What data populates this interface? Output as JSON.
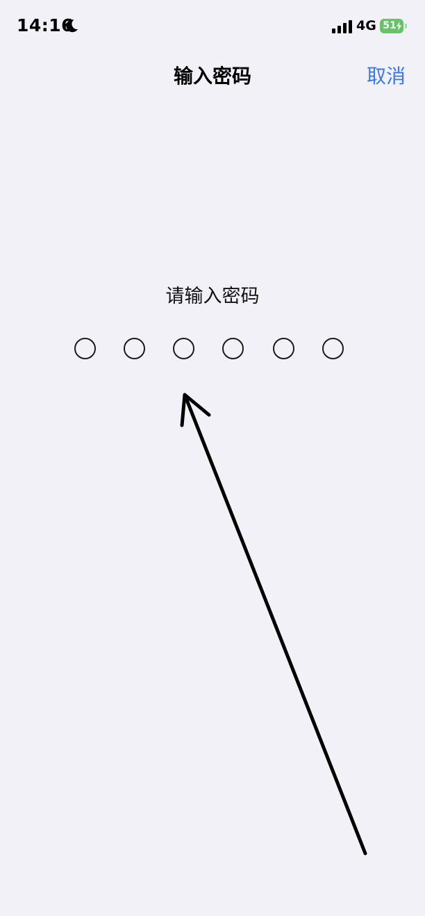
{
  "status_bar": {
    "time": "14:16",
    "network": "4G",
    "battery": "51",
    "icons": [
      "moon-icon",
      "signal-icon",
      "battery-icon",
      "charging-bolt-icon"
    ]
  },
  "header": {
    "title": "输入密码",
    "cancel_label": "取消"
  },
  "passcode": {
    "prompt": "请输入密码",
    "digits_total": 6,
    "digits_entered": 0
  },
  "colors": {
    "background": "#f2f1f7",
    "accent": "#3478f6",
    "battery": "#65c466"
  }
}
